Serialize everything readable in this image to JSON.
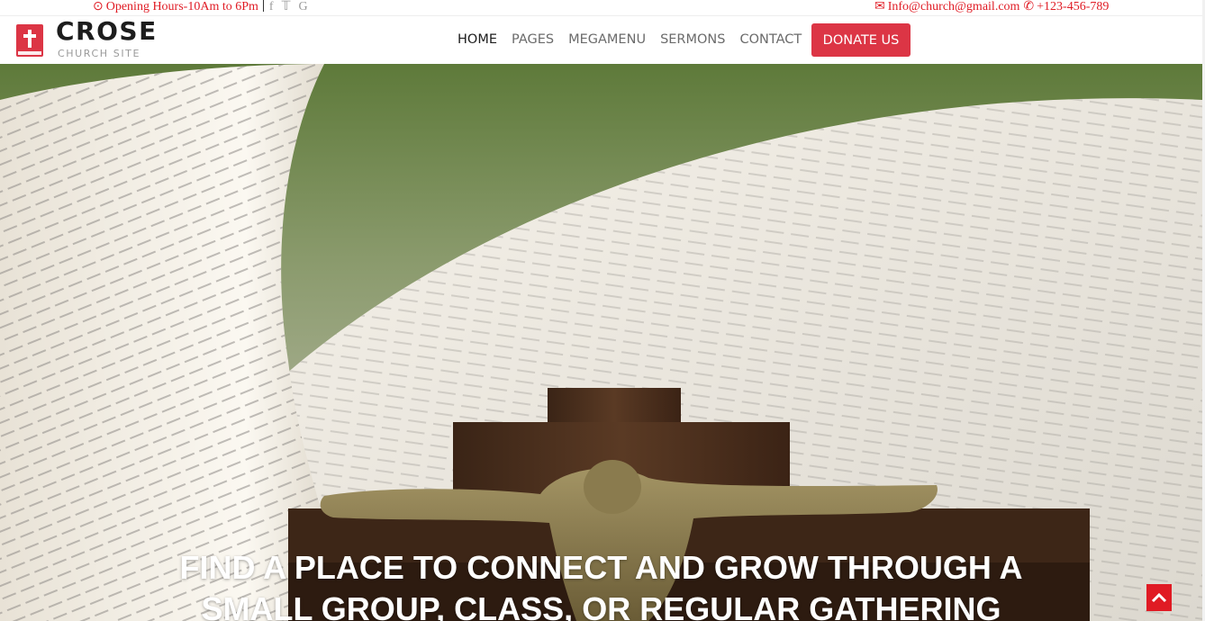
{
  "topbar": {
    "hours_text": "Opening Hours-10Am to 6Pm",
    "clock_icon": "clock-icon",
    "social": [
      "facebook-icon",
      "twitter-icon",
      "google-icon"
    ],
    "social_glyphs": [
      "f",
      "🐦",
      "G"
    ],
    "email": "Info@church@gmail.com",
    "phone": "+123-456-789"
  },
  "header": {
    "brand": "CROSE",
    "tagline": "CHURCH SITE",
    "nav": [
      {
        "label": "HOME",
        "active": true
      },
      {
        "label": "PAGES",
        "active": false
      },
      {
        "label": "MEGAMENU",
        "active": false
      },
      {
        "label": "SERMONS",
        "active": false
      },
      {
        "label": "CONTACT",
        "active": false
      }
    ],
    "donate_label": "DONATE US"
  },
  "hero": {
    "headline_line1": "FIND A PLACE TO CONNECT AND GROW THROUGH A",
    "headline_line2": "SMALL GROUP, CLASS, OR REGULAR GATHERING"
  },
  "colors": {
    "accent": "#dc3545",
    "topbar_red": "#e01b24"
  }
}
